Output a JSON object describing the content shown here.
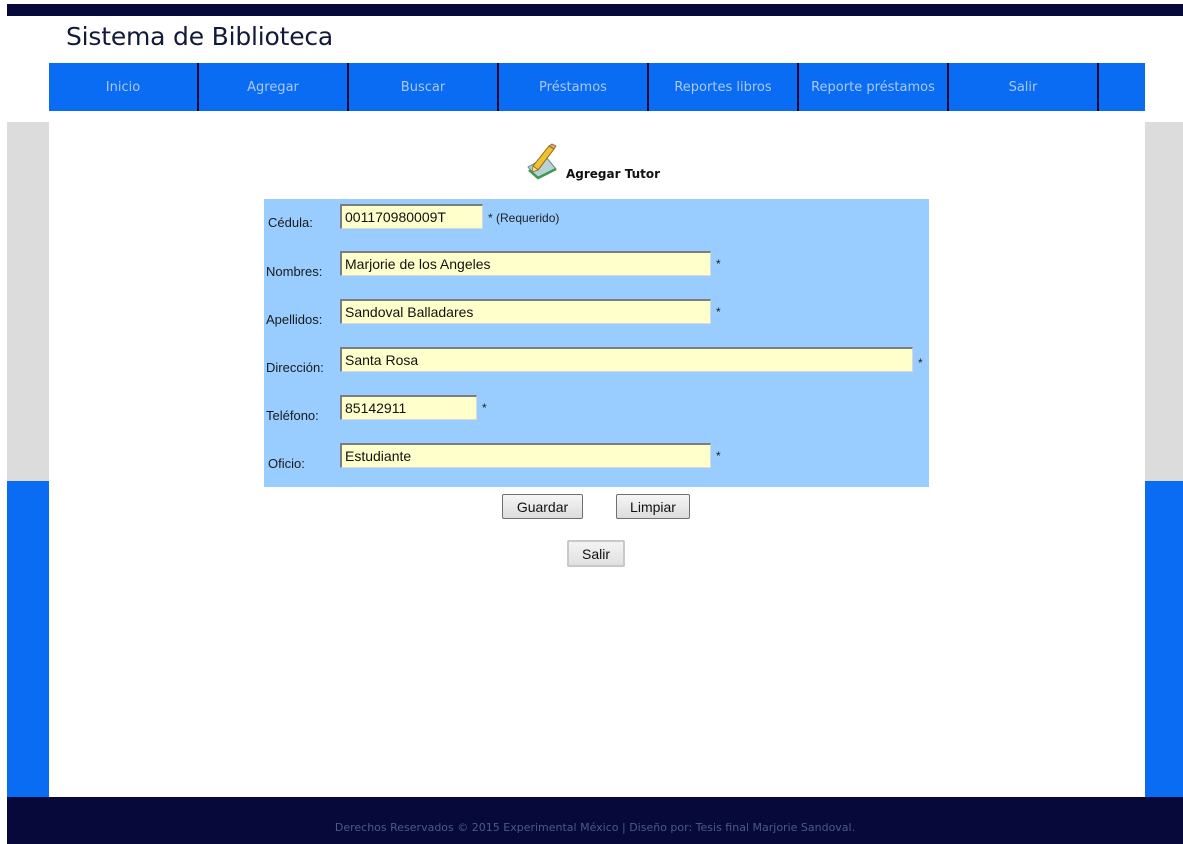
{
  "header": {
    "title": "Sistema de Biblioteca"
  },
  "nav": {
    "items": [
      {
        "label": "Inicio"
      },
      {
        "label": "Agregar"
      },
      {
        "label": "Buscar"
      },
      {
        "label": "Préstamos"
      },
      {
        "label": "Reportes libros"
      },
      {
        "label": "Reporte préstamos"
      },
      {
        "label": "Salir"
      }
    ]
  },
  "form": {
    "icon": "pencil-notepad-icon",
    "title": "Agregar Tutor",
    "fields": {
      "cedula": {
        "label": "Cédula:",
        "value": "001170980009T",
        "note": "* (Requerido)"
      },
      "nombres": {
        "label": "Nombres:",
        "value": "Marjorie de los Angeles",
        "note": "*"
      },
      "apellidos": {
        "label": "Apellidos:",
        "value": "Sandoval Balladares",
        "note": "*"
      },
      "direccion": {
        "label": "Dirección:",
        "value": "Santa Rosa",
        "note": "*"
      },
      "telefono": {
        "label": "Teléfono:",
        "value": "85142911",
        "note": "*"
      },
      "oficio": {
        "label": "Oficio:",
        "value": "Estudiante",
        "note": "*"
      }
    },
    "buttons": {
      "save": "Guardar",
      "clear": "Limpiar",
      "exit": "Salir"
    }
  },
  "footer": {
    "text": "Derechos Reservados © 2015 Experimental México | Diseño por: Tesis final Marjorie Sandoval."
  },
  "colors": {
    "nav_bg": "#0a6bf3",
    "dark_bar": "#07093b",
    "panel_bg": "#99ccff",
    "field_bg": "#ffffcc"
  }
}
